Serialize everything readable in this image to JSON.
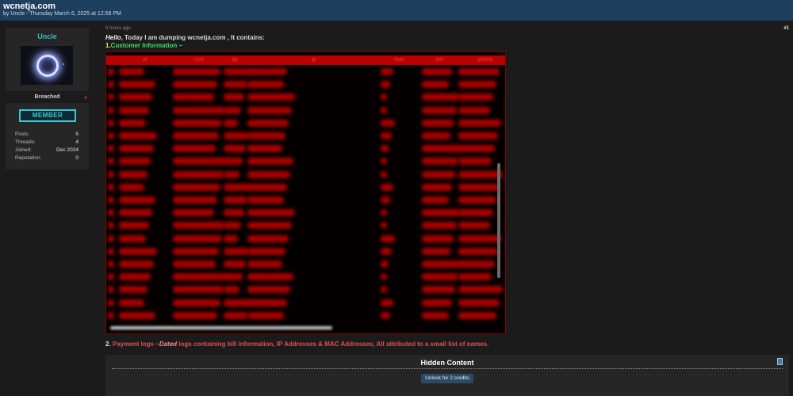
{
  "thread": {
    "title": "wcnetja.com",
    "meta": "by Uncle - Thursday March 6, 2025 at 12:58 PM"
  },
  "user": {
    "name": "Uncle",
    "group": "Breached",
    "rank_badge": "MEMBER",
    "stats": [
      {
        "label": "Posts:",
        "value": "5"
      },
      {
        "label": "Threads:",
        "value": "4"
      },
      {
        "label": "Joined:",
        "value": "Dec 2024"
      },
      {
        "label": "Reputation:",
        "value": "0"
      }
    ]
  },
  "post": {
    "time": "5 hours ago",
    "number": "#1",
    "intro_hello": "Hello",
    "intro_rest": ", Today I am dumping wcnetja.com , It contains:",
    "item1_prefix": "1.",
    "item1_label": "Customer Information ~",
    "dump_columns": [
      "id",
      "cust",
      "ap",
      "ip",
      "mac",
      "bill",
      "phone"
    ],
    "item2_number": "2.",
    "item2_prefix": "Payment logs ~",
    "item2_dated": "Dated",
    "item2_rest": " logs containing bill information, IP Addresses & MAC Addresses, All attributed to a small list of names.",
    "hidden_title": "Hidden Content",
    "unlock_label": "Unlock for 2 credits"
  },
  "colors": {
    "topbar": "#1f3f5f",
    "username": "#3fb6c8",
    "dump_red": "#b80000",
    "item1_green": "#40e060",
    "item2_red": "#e05050"
  }
}
